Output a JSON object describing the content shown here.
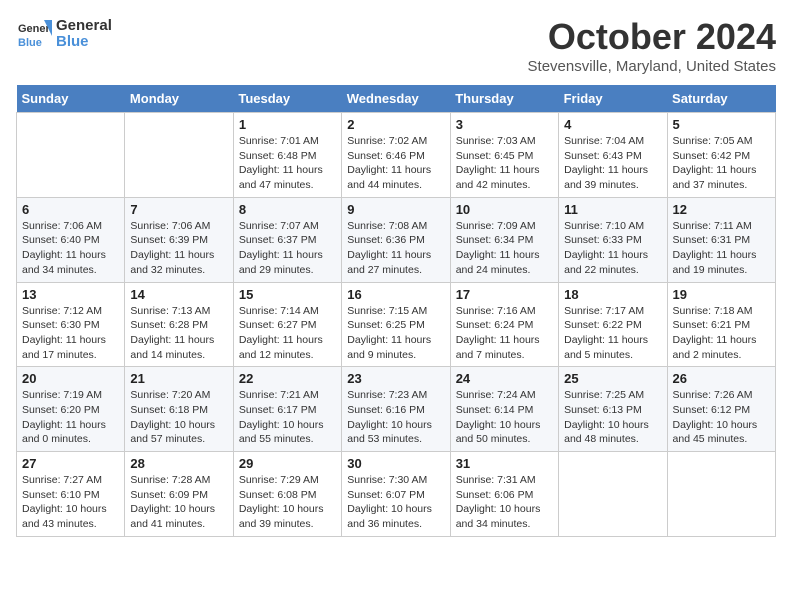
{
  "header": {
    "logo_line1": "General",
    "logo_line2": "Blue",
    "month": "October 2024",
    "location": "Stevensville, Maryland, United States"
  },
  "weekdays": [
    "Sunday",
    "Monday",
    "Tuesday",
    "Wednesday",
    "Thursday",
    "Friday",
    "Saturday"
  ],
  "weeks": [
    [
      {
        "day": "",
        "info": ""
      },
      {
        "day": "",
        "info": ""
      },
      {
        "day": "1",
        "info": "Sunrise: 7:01 AM\nSunset: 6:48 PM\nDaylight: 11 hours and 47 minutes."
      },
      {
        "day": "2",
        "info": "Sunrise: 7:02 AM\nSunset: 6:46 PM\nDaylight: 11 hours and 44 minutes."
      },
      {
        "day": "3",
        "info": "Sunrise: 7:03 AM\nSunset: 6:45 PM\nDaylight: 11 hours and 42 minutes."
      },
      {
        "day": "4",
        "info": "Sunrise: 7:04 AM\nSunset: 6:43 PM\nDaylight: 11 hours and 39 minutes."
      },
      {
        "day": "5",
        "info": "Sunrise: 7:05 AM\nSunset: 6:42 PM\nDaylight: 11 hours and 37 minutes."
      }
    ],
    [
      {
        "day": "6",
        "info": "Sunrise: 7:06 AM\nSunset: 6:40 PM\nDaylight: 11 hours and 34 minutes."
      },
      {
        "day": "7",
        "info": "Sunrise: 7:06 AM\nSunset: 6:39 PM\nDaylight: 11 hours and 32 minutes."
      },
      {
        "day": "8",
        "info": "Sunrise: 7:07 AM\nSunset: 6:37 PM\nDaylight: 11 hours and 29 minutes."
      },
      {
        "day": "9",
        "info": "Sunrise: 7:08 AM\nSunset: 6:36 PM\nDaylight: 11 hours and 27 minutes."
      },
      {
        "day": "10",
        "info": "Sunrise: 7:09 AM\nSunset: 6:34 PM\nDaylight: 11 hours and 24 minutes."
      },
      {
        "day": "11",
        "info": "Sunrise: 7:10 AM\nSunset: 6:33 PM\nDaylight: 11 hours and 22 minutes."
      },
      {
        "day": "12",
        "info": "Sunrise: 7:11 AM\nSunset: 6:31 PM\nDaylight: 11 hours and 19 minutes."
      }
    ],
    [
      {
        "day": "13",
        "info": "Sunrise: 7:12 AM\nSunset: 6:30 PM\nDaylight: 11 hours and 17 minutes."
      },
      {
        "day": "14",
        "info": "Sunrise: 7:13 AM\nSunset: 6:28 PM\nDaylight: 11 hours and 14 minutes."
      },
      {
        "day": "15",
        "info": "Sunrise: 7:14 AM\nSunset: 6:27 PM\nDaylight: 11 hours and 12 minutes."
      },
      {
        "day": "16",
        "info": "Sunrise: 7:15 AM\nSunset: 6:25 PM\nDaylight: 11 hours and 9 minutes."
      },
      {
        "day": "17",
        "info": "Sunrise: 7:16 AM\nSunset: 6:24 PM\nDaylight: 11 hours and 7 minutes."
      },
      {
        "day": "18",
        "info": "Sunrise: 7:17 AM\nSunset: 6:22 PM\nDaylight: 11 hours and 5 minutes."
      },
      {
        "day": "19",
        "info": "Sunrise: 7:18 AM\nSunset: 6:21 PM\nDaylight: 11 hours and 2 minutes."
      }
    ],
    [
      {
        "day": "20",
        "info": "Sunrise: 7:19 AM\nSunset: 6:20 PM\nDaylight: 11 hours and 0 minutes."
      },
      {
        "day": "21",
        "info": "Sunrise: 7:20 AM\nSunset: 6:18 PM\nDaylight: 10 hours and 57 minutes."
      },
      {
        "day": "22",
        "info": "Sunrise: 7:21 AM\nSunset: 6:17 PM\nDaylight: 10 hours and 55 minutes."
      },
      {
        "day": "23",
        "info": "Sunrise: 7:23 AM\nSunset: 6:16 PM\nDaylight: 10 hours and 53 minutes."
      },
      {
        "day": "24",
        "info": "Sunrise: 7:24 AM\nSunset: 6:14 PM\nDaylight: 10 hours and 50 minutes."
      },
      {
        "day": "25",
        "info": "Sunrise: 7:25 AM\nSunset: 6:13 PM\nDaylight: 10 hours and 48 minutes."
      },
      {
        "day": "26",
        "info": "Sunrise: 7:26 AM\nSunset: 6:12 PM\nDaylight: 10 hours and 45 minutes."
      }
    ],
    [
      {
        "day": "27",
        "info": "Sunrise: 7:27 AM\nSunset: 6:10 PM\nDaylight: 10 hours and 43 minutes."
      },
      {
        "day": "28",
        "info": "Sunrise: 7:28 AM\nSunset: 6:09 PM\nDaylight: 10 hours and 41 minutes."
      },
      {
        "day": "29",
        "info": "Sunrise: 7:29 AM\nSunset: 6:08 PM\nDaylight: 10 hours and 39 minutes."
      },
      {
        "day": "30",
        "info": "Sunrise: 7:30 AM\nSunset: 6:07 PM\nDaylight: 10 hours and 36 minutes."
      },
      {
        "day": "31",
        "info": "Sunrise: 7:31 AM\nSunset: 6:06 PM\nDaylight: 10 hours and 34 minutes."
      },
      {
        "day": "",
        "info": ""
      },
      {
        "day": "",
        "info": ""
      }
    ]
  ]
}
